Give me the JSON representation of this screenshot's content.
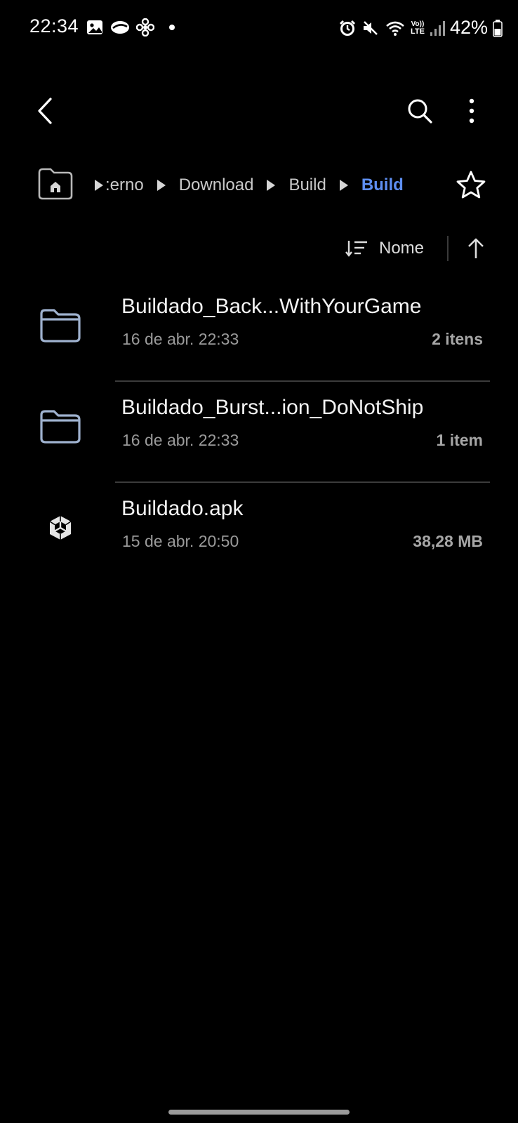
{
  "status_bar": {
    "time": "22:34",
    "left_icons": [
      "gallery-icon",
      "cloud-icon",
      "fan-icon",
      "notification-dot-icon"
    ],
    "right_icons": [
      "alarm-icon",
      "mute-icon",
      "wifi-icon",
      "volte-lte-icon",
      "signal-icon",
      "battery-icon"
    ],
    "volte_text": "Vo))",
    "lte_text": "LTE",
    "battery_percent": "42%"
  },
  "app_bar": {
    "back_icon": "back-arrow-icon",
    "search_icon": "search-icon",
    "more_icon": "more-vertical-icon"
  },
  "breadcrumb": {
    "home_icon": "home-folder-icon",
    "items": [
      {
        "label": ":erno",
        "current": false
      },
      {
        "label": "Download",
        "current": false
      },
      {
        "label": "Build",
        "current": false
      },
      {
        "label": "Build",
        "current": true
      }
    ],
    "favorite_icon": "star-icon"
  },
  "sort": {
    "label": "Nome",
    "sort_icon": "sort-icon",
    "direction_icon": "arrow-up-icon"
  },
  "files": [
    {
      "name": "Buildado_Back...WithYourGame",
      "date": "16 de abr. 22:33",
      "meta": "2 itens",
      "type": "folder",
      "icon": "folder-icon"
    },
    {
      "name": "Buildado_Burst...ion_DoNotShip",
      "date": "16 de abr. 22:33",
      "meta": "1 item",
      "type": "folder",
      "icon": "folder-icon"
    },
    {
      "name": "Buildado.apk",
      "date": "15 de abr. 20:50",
      "meta": "38,28 MB",
      "type": "apk",
      "icon": "unity-cube-icon"
    }
  ],
  "colors": {
    "background": "#000000",
    "accent": "#5e8ff2",
    "folder_outline": "#9fb2cf",
    "secondary_text": "#9a9a9a"
  }
}
